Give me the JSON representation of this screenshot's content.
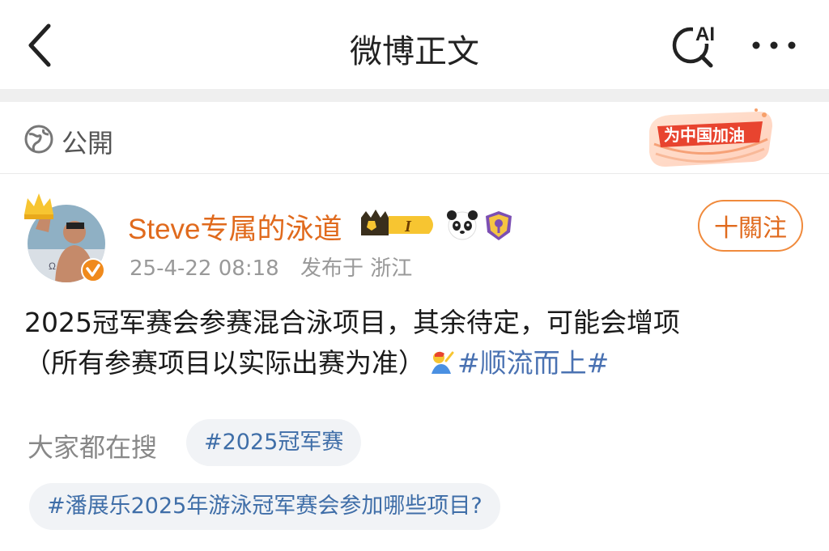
{
  "header": {
    "title": "微博正文",
    "ai_label": "AI"
  },
  "visibility": {
    "label": "公開",
    "banner_text": "为中国加油"
  },
  "author": {
    "name": "Steve专属的泳道",
    "level_badge": "I",
    "timestamp": "25-4-22 08:18",
    "location": "发布于 浙江",
    "follow_label": "十關注"
  },
  "post": {
    "line1": "2025冠军赛会参赛混合泳项目，其余待定，可能会增项",
    "line2": "（所有参赛项目以实际出赛为准）",
    "topic": "#顺流而上#"
  },
  "trending": {
    "label": "大家都在搜",
    "chips": [
      "#2025冠军赛",
      "#潘展乐2025年游泳冠军赛会参加哪些项目?"
    ]
  },
  "colors": {
    "username": "#e06a1d",
    "topic": "#4a72b2",
    "follow_border": "#f08a3c",
    "chip_bg": "#f1f3f6",
    "divider": "#efefef"
  }
}
